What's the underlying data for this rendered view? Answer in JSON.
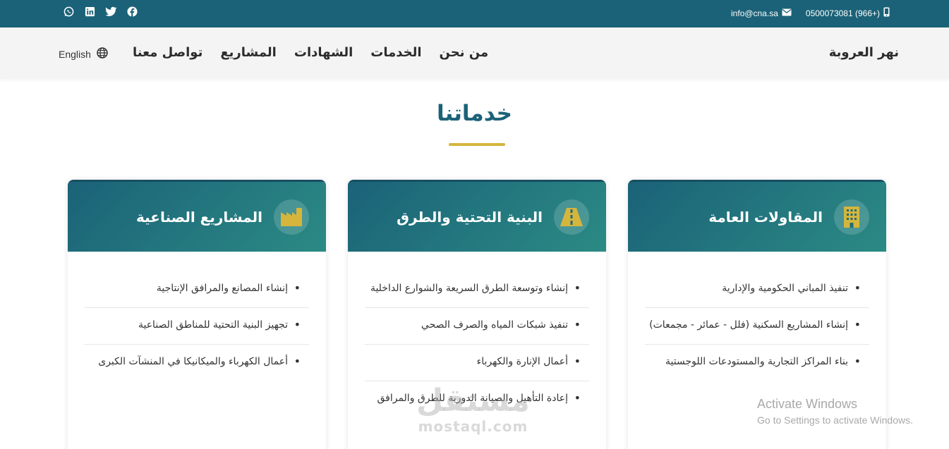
{
  "topbar": {
    "social_icons": [
      "whatsapp-icon",
      "linkedin-icon",
      "twitter-icon",
      "facebook-icon"
    ],
    "email": "info@cna.sa",
    "phone": "0500073081 (966+)"
  },
  "navbar": {
    "brand": "نهر العروبة",
    "menu": [
      "من نحن",
      "الخدمات",
      "الشهادات",
      "المشاريع",
      "تواصل معنا"
    ],
    "language": "English"
  },
  "section": {
    "title": "خدماتنا"
  },
  "cards": [
    {
      "title": "المقاولات العامة",
      "icon": "building-icon",
      "items": [
        "تنفيذ المباني الحكومية والإدارية",
        "إنشاء المشاريع السكنية (فلل - عمائر - مجمعات)",
        "بناء المراكز التجارية والمستودعات اللوجستية"
      ]
    },
    {
      "title": "البنية التحتية والطرق",
      "icon": "road-icon",
      "items": [
        "إنشاء وتوسعة الطرق السريعة والشوارع الداخلية",
        "تنفيذ شبكات المياه والصرف الصحي",
        "أعمال الإنارة والكهرباء",
        "إعادة التأهيل والصيانة الدورية للطرق والمرافق"
      ]
    },
    {
      "title": "المشاريع الصناعية",
      "icon": "industry-icon",
      "items": [
        "إنشاء المصانع والمرافق الإنتاجية",
        "تجهيز البنية التحتية للمناطق الصناعية",
        "أعمال الكهرباء والميكانيكا في المنشآت الكبرى"
      ]
    }
  ],
  "overlay": {
    "activate_title": "Activate Windows",
    "activate_sub": "Go to Settings to activate Windows.",
    "watermark_ar": "مستقل",
    "watermark_en": "mostaql.com"
  },
  "colors": {
    "primary": "#1b6278",
    "accent_gold": "#d6b53c",
    "teal": "#2b8a84"
  }
}
